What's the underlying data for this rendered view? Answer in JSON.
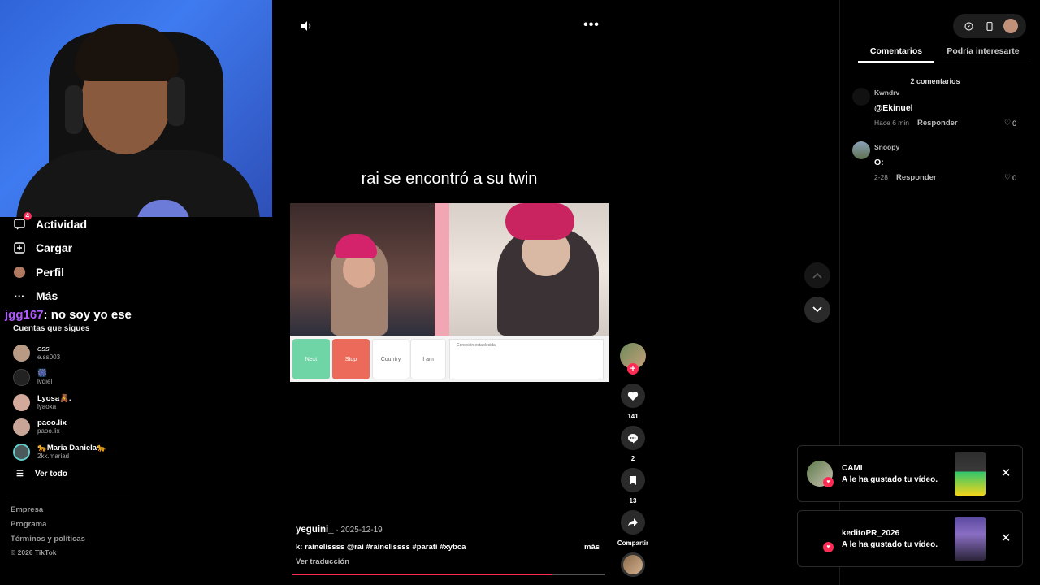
{
  "sidebar": {
    "nav": [
      {
        "label": "Actividad",
        "badge": "4"
      },
      {
        "label": "Cargar"
      },
      {
        "label": "Perfil"
      },
      {
        "label": "Más"
      }
    ],
    "chat": {
      "user": "jgg167",
      "message": ": no soy yo ese"
    },
    "following_title": "Cuentas que sigues",
    "accounts": [
      {
        "name": "ess",
        "handle": "e.ss003"
      },
      {
        "name": "🎆",
        "handle": "lvdiel"
      },
      {
        "name": "Lyosa🧸.",
        "handle": "lyaoxa"
      },
      {
        "name": "paoo.lix",
        "handle": "paoo.lix"
      },
      {
        "name": "🐆Maria Daniela🐆",
        "handle": "2kk.mariad"
      }
    ],
    "see_all": "Ver todo",
    "footer": [
      "Empresa",
      "Programa",
      "Términos y políticas"
    ],
    "copyright": "© 2026 TikTok"
  },
  "video": {
    "caption": "rai se encontró a su twin",
    "author": "yeguini_",
    "date": " · 2025-12-19",
    "description": "k: rainelissss @rai #rainelissss #parati #xybca",
    "more": "más",
    "translate": "Ver traducción",
    "progress": 0.83,
    "frame": {
      "buttons": [
        "Next",
        "Stop",
        "Country",
        "I am"
      ],
      "chat_text": "Conexión establecida"
    }
  },
  "actions": {
    "likes": "141",
    "comments": "2",
    "saves": "13",
    "share": "Compartir"
  },
  "comments_panel": {
    "tabs": [
      "Comentarios",
      "Podría interesarte"
    ],
    "count": "2 comentarios",
    "items": [
      {
        "user": "Kwndrv",
        "text": "@Ekinuel",
        "time": "Hace 6 min",
        "reply": "Responder",
        "likes": "0"
      },
      {
        "user": "Snoopy",
        "text": "O:",
        "time": "2-28",
        "reply": "Responder",
        "likes": "0"
      }
    ]
  },
  "notifications": [
    {
      "name": "CAMI",
      "message": "A le ha gustado tu vídeo."
    },
    {
      "name": "keditoPR_2026",
      "message": "A le ha gustado tu vídeo."
    }
  ],
  "colors": {
    "accent": "#fe2c55",
    "chat_user": "#b25cff"
  }
}
